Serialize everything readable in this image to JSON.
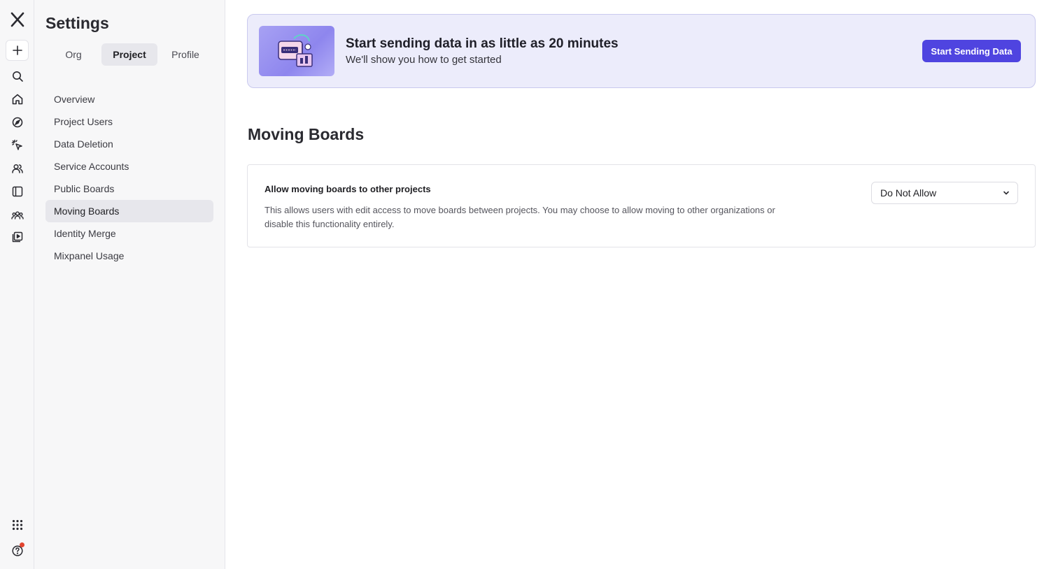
{
  "settings": {
    "title": "Settings",
    "tabs": [
      {
        "label": "Org",
        "active": false
      },
      {
        "label": "Project",
        "active": true
      },
      {
        "label": "Profile",
        "active": false
      }
    ],
    "nav": [
      {
        "label": "Overview",
        "active": false
      },
      {
        "label": "Project Users",
        "active": false
      },
      {
        "label": "Data Deletion",
        "active": false
      },
      {
        "label": "Service Accounts",
        "active": false
      },
      {
        "label": "Public Boards",
        "active": false
      },
      {
        "label": "Moving Boards",
        "active": true
      },
      {
        "label": "Identity Merge",
        "active": false
      },
      {
        "label": "Mixpanel Usage",
        "active": false
      }
    ]
  },
  "rail": {
    "icons": [
      "mixpanel-logo-icon",
      "plus-icon",
      "search-icon",
      "home-icon",
      "compass-icon",
      "sparkle-cursor-icon",
      "users-icon",
      "boards-icon",
      "cohorts-icon",
      "session-replay-icon",
      "apps-grid-icon",
      "help-icon"
    ],
    "notification_color": "#e2442f"
  },
  "banner": {
    "title": "Start sending data in as little as 20 minutes",
    "subtitle": "We'll show you how to get started",
    "button_label": "Start Sending Data",
    "accent_color": "#4f44e0",
    "background_color": "#ececfb"
  },
  "section": {
    "title": "Moving Boards",
    "setting": {
      "label": "Allow moving boards to other projects",
      "description": "This allows users with edit access to move boards between projects. You may choose to allow moving to other organizations or disable this functionality entirely.",
      "selected_value": "Do Not Allow"
    }
  }
}
